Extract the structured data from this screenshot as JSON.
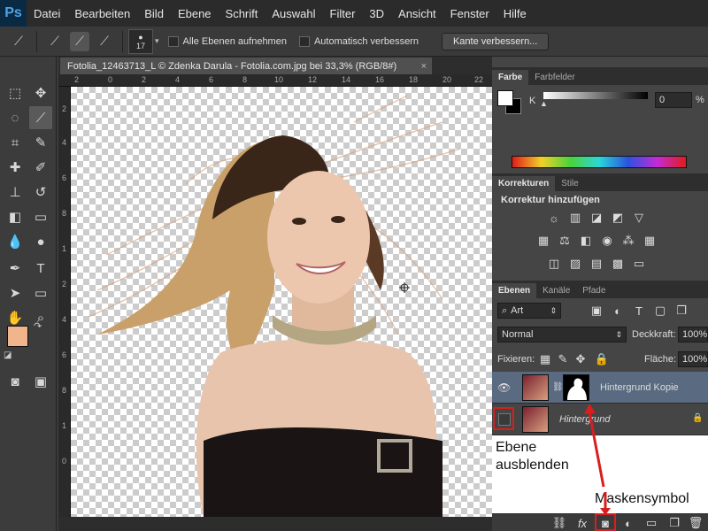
{
  "app": {
    "logo": "Ps"
  },
  "menu": [
    "Datei",
    "Bearbeiten",
    "Bild",
    "Ebene",
    "Schrift",
    "Auswahl",
    "Filter",
    "3D",
    "Ansicht",
    "Fenster",
    "Hilfe"
  ],
  "options": {
    "brush_size": "17",
    "sample_all_layers": "Alle Ebenen aufnehmen",
    "auto_enhance": "Automatisch verbessern",
    "refine_edge": "Kante verbessern..."
  },
  "document": {
    "tab_title": "Fotolia_12463713_L © Zdenka Darula - Fotolia.com.jpg bei 33,3% (RGB/8#)",
    "close": "×",
    "ruler_h": [
      "2",
      "0",
      "2",
      "4",
      "6",
      "8",
      "10",
      "12",
      "14",
      "16",
      "18",
      "20",
      "22"
    ],
    "ruler_v": [
      "2",
      "4",
      "6",
      "8",
      "1",
      "2",
      "4",
      "6",
      "8",
      "1",
      "0"
    ]
  },
  "color_panel": {
    "tabs": [
      "Farbe",
      "Farbfelder"
    ],
    "channel": "K",
    "value": "0",
    "unit": "%"
  },
  "adjustments_panel": {
    "tabs": [
      "Korrekturen",
      "Stile"
    ],
    "title": "Korrektur hinzufügen"
  },
  "layers_panel": {
    "tabs": [
      "Ebenen",
      "Kanäle",
      "Pfade"
    ],
    "filter": "Art",
    "blend_mode": "Normal",
    "opacity_label": "Deckkraft:",
    "opacity": "100%",
    "lock_label": "Fixieren:",
    "fill_label": "Fläche:",
    "fill": "100%",
    "layers": [
      {
        "name": "Hintergrund Kopie",
        "visible": true,
        "has_mask": true
      },
      {
        "name": "Hintergrund",
        "visible": false,
        "locked": true
      }
    ]
  },
  "annotations": {
    "hide_layer": "Ebene ausblenden",
    "mask_symbol": "Maskensymbol"
  },
  "colors": {
    "foreground": "#f0b58a",
    "background": "#1a6fb8",
    "selected_layer": "#5a6a80",
    "annotation": "#d81e1e"
  }
}
